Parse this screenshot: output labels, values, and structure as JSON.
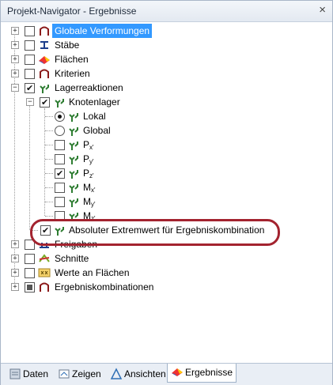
{
  "window": {
    "title": "Projekt-Navigator - Ergebnisse",
    "close_symbol": "×"
  },
  "tree": {
    "items": [
      {
        "label": "Globale Verformungen",
        "selected": true,
        "check": "unchecked",
        "icon": "deformation-icon"
      },
      {
        "label": "Stäbe",
        "check": "unchecked",
        "icon": "member-icon"
      },
      {
        "label": "Flächen",
        "check": "unchecked",
        "icon": "surface-icon"
      },
      {
        "label": "Kriterien",
        "check": "unchecked",
        "icon": "criteria-icon"
      },
      {
        "label": "Lagerreaktionen",
        "check": "checked",
        "icon": "support-reaction-icon"
      },
      {
        "label": "Knotenlager",
        "check": "checked",
        "icon": "support-reaction-icon"
      },
      {
        "label": "Lokal",
        "radio": "on",
        "icon": "support-reaction-icon"
      },
      {
        "label": "Global",
        "radio": "off",
        "icon": "support-reaction-icon"
      },
      {
        "label": "P",
        "sub": "x'",
        "check": "unchecked",
        "icon": "support-reaction-icon"
      },
      {
        "label": "P",
        "sub": "y'",
        "check": "unchecked",
        "icon": "support-reaction-icon"
      },
      {
        "label": "P",
        "sub": "z'",
        "check": "checked",
        "icon": "support-reaction-icon"
      },
      {
        "label": "M",
        "sub": "x'",
        "check": "unchecked",
        "icon": "support-reaction-icon"
      },
      {
        "label": "M",
        "sub": "y'",
        "check": "unchecked",
        "icon": "support-reaction-icon"
      },
      {
        "label": "M",
        "sub": "z'",
        "check": "unchecked",
        "icon": "support-reaction-icon"
      },
      {
        "label": "Absoluter Extremwert für Ergebniskombination",
        "check": "checked",
        "icon": "support-reaction-icon",
        "highlighted": true
      },
      {
        "label": "Freigaben",
        "check": "unchecked",
        "icon": "release-icon"
      },
      {
        "label": "Schnitte",
        "check": "unchecked",
        "icon": "section-icon"
      },
      {
        "label": "Werte an Flächen",
        "check": "unchecked",
        "icon": "values-icon"
      },
      {
        "label": "Ergebniskombinationen",
        "check": "partial",
        "icon": "criteria-icon"
      }
    ]
  },
  "tabs": [
    {
      "label": "Daten",
      "icon": "data-icon"
    },
    {
      "label": "Zeigen",
      "icon": "display-icon"
    },
    {
      "label": "Ansichten",
      "icon": "views-icon"
    },
    {
      "label": "Ergebnisse",
      "icon": "results-icon",
      "active": true
    }
  ],
  "colors": {
    "selection": "#3399ff",
    "highlight_ring": "#a3232f",
    "support_icon": "#2e7d32"
  }
}
